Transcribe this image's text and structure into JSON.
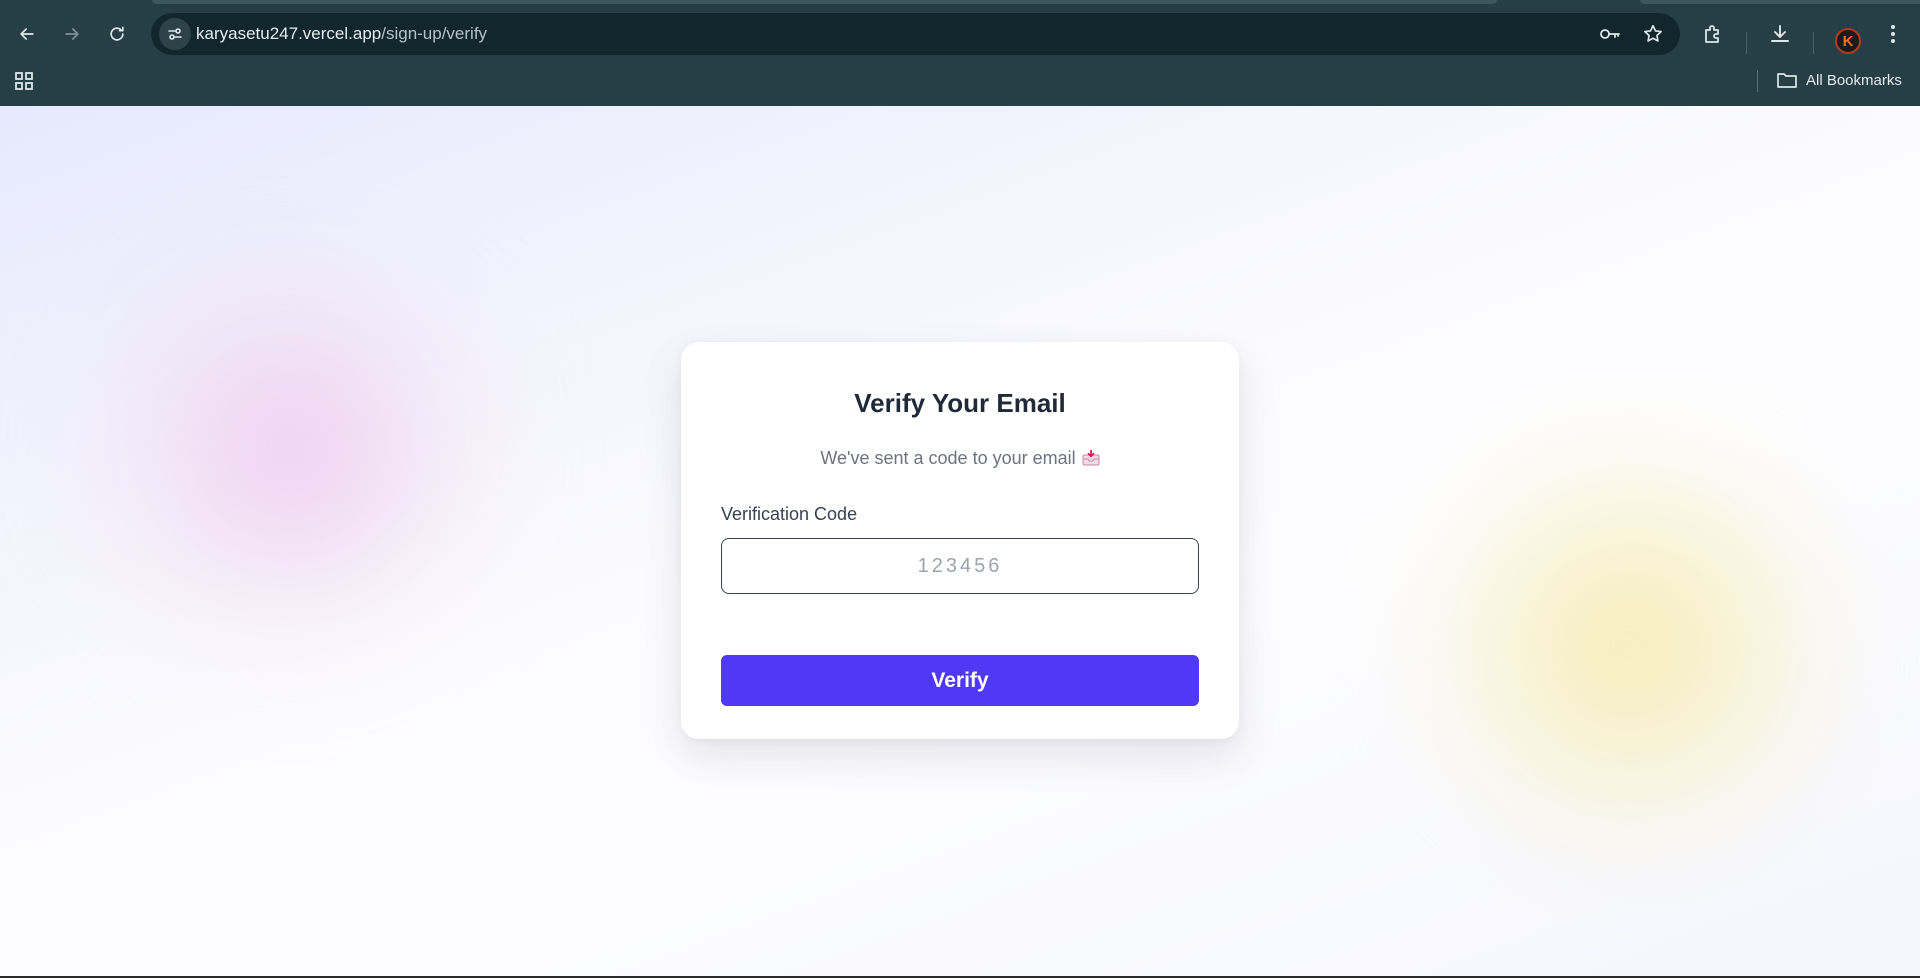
{
  "browser": {
    "url_host": "karyasetu247.vercel.app",
    "url_path": "/sign-up/verify",
    "bookmarks_label": "All Bookmarks",
    "profile_initial": "K",
    "icons": {
      "back": "arrow-left-icon",
      "forward": "arrow-right-icon",
      "reload": "reload-icon",
      "site_info": "tune-icon",
      "passwords": "key-icon",
      "bookmark": "star-icon",
      "extensions": "puzzle-icon",
      "downloads": "download-icon",
      "menu": "kebab-menu-icon",
      "apps": "apps-grid-icon",
      "folder": "folder-icon"
    }
  },
  "verify": {
    "title": "Verify Your Email",
    "subtitle": "We've sent a code to your email",
    "subtitle_icon": "inbox-tray-emoji",
    "field_label": "Verification Code",
    "code_placeholder": "123456",
    "code_value": "",
    "button_label": "Verify"
  },
  "colors": {
    "primary": "#4f39f6",
    "title": "#1f2937",
    "muted": "#6b7280",
    "chrome_bg": "#263f47"
  }
}
